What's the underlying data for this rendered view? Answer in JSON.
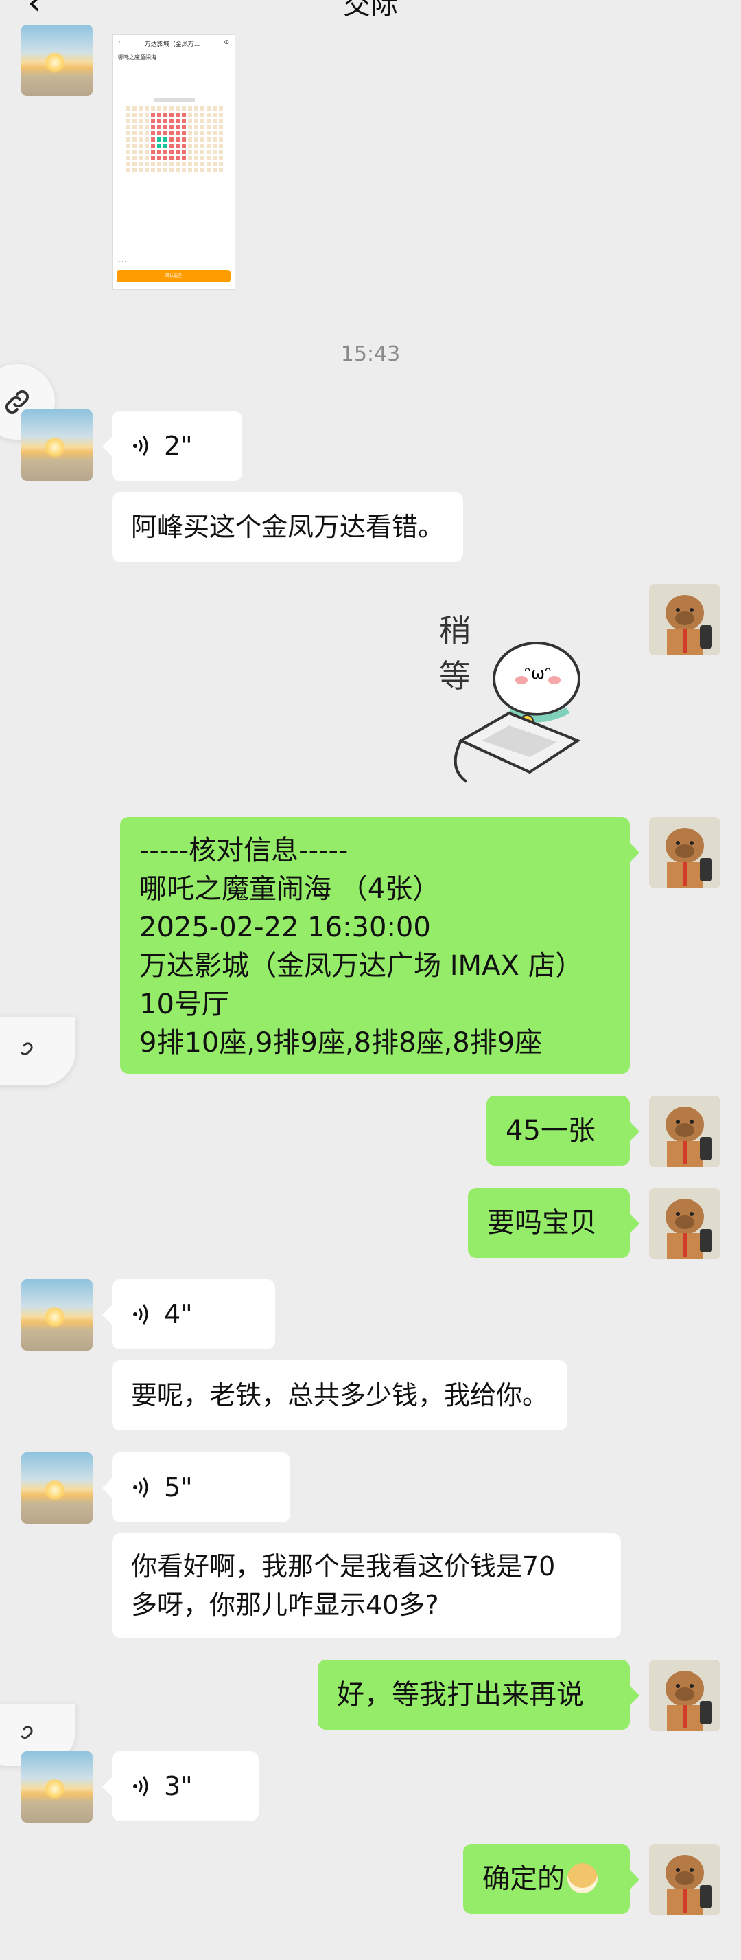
{
  "header": {
    "back_icon": "chevron-left-icon",
    "title": "交际"
  },
  "shared_image": {
    "cinema": "万达影城（金凤万...",
    "movie": "哪吒之魔童闹海",
    "confirm_button": "确认选座"
  },
  "timestamp": "15:43",
  "messages": [
    {
      "id": "m1",
      "side": "left",
      "type": "voice",
      "duration": "2\""
    },
    {
      "id": "m2",
      "side": "left",
      "type": "text",
      "text": "阿峰买这个金凤万达看错。"
    },
    {
      "id": "m3",
      "side": "right",
      "type": "sticker",
      "text": "稍等"
    },
    {
      "id": "m4",
      "side": "right",
      "type": "text",
      "lines": [
        "-----核对信息-----",
        "哪吒之魔童闹海 （4张）",
        "2025-02-22 16:30:00",
        "万达影城（金凤万达广场 IMAX 店）",
        "10号厅",
        "9排10座,9排9座,8排8座,8排9座"
      ]
    },
    {
      "id": "m5",
      "side": "right",
      "type": "text",
      "text": "45一张"
    },
    {
      "id": "m6",
      "side": "right",
      "type": "text",
      "text": "要吗宝贝"
    },
    {
      "id": "m7",
      "side": "left",
      "type": "voice",
      "duration": "4\""
    },
    {
      "id": "m8",
      "side": "left",
      "type": "text",
      "text": "要呢，老铁，总共多少钱，我给你。"
    },
    {
      "id": "m9",
      "side": "left",
      "type": "voice",
      "duration": "5\""
    },
    {
      "id": "m10",
      "side": "left",
      "type": "text",
      "lines": [
        "你看好啊，我那个是我看这价钱是70",
        "多呀，你那儿咋显示40多?"
      ]
    },
    {
      "id": "m11",
      "side": "right",
      "type": "text",
      "text": "好，等我打出来再说"
    },
    {
      "id": "m12",
      "side": "left",
      "type": "voice",
      "duration": "3\""
    },
    {
      "id": "m13",
      "side": "right",
      "type": "text",
      "text": "确定的",
      "emoji": "doge-emoji"
    }
  ],
  "colors": {
    "background": "#ededed",
    "green_bubble": "#95ec69",
    "white_bubble": "#ffffff",
    "timestamp": "#8a8a8a"
  }
}
